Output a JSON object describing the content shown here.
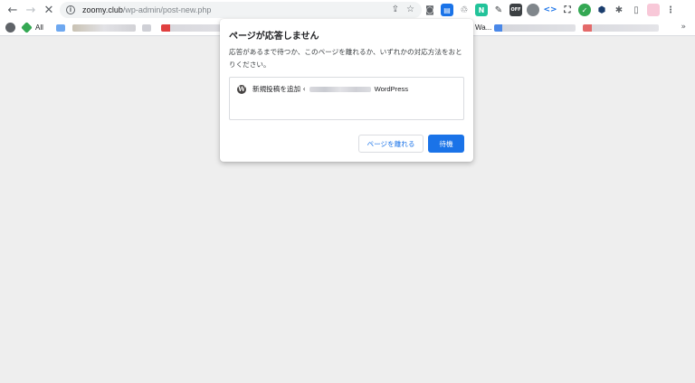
{
  "browser": {
    "url_host": "zoomy.club",
    "url_path": "/wp-admin/post-new.php",
    "bookmarks": {
      "all_label": "All",
      "partial_label": "Wa..."
    },
    "extension_off_badge": "OFF"
  },
  "dialog": {
    "title": "ページが応答しません",
    "message": "応答があるまで待つか、このページを離れるか、いずれかの対応方法をおとりください。",
    "list_item": {
      "prefix": "新規投稿を追加 ‹",
      "suffix": "WordPress"
    },
    "leave_button": "ページを離れる",
    "wait_button": "待機"
  },
  "colors": {
    "accent": "#1a73e8",
    "page_background": "#eeeeee"
  }
}
